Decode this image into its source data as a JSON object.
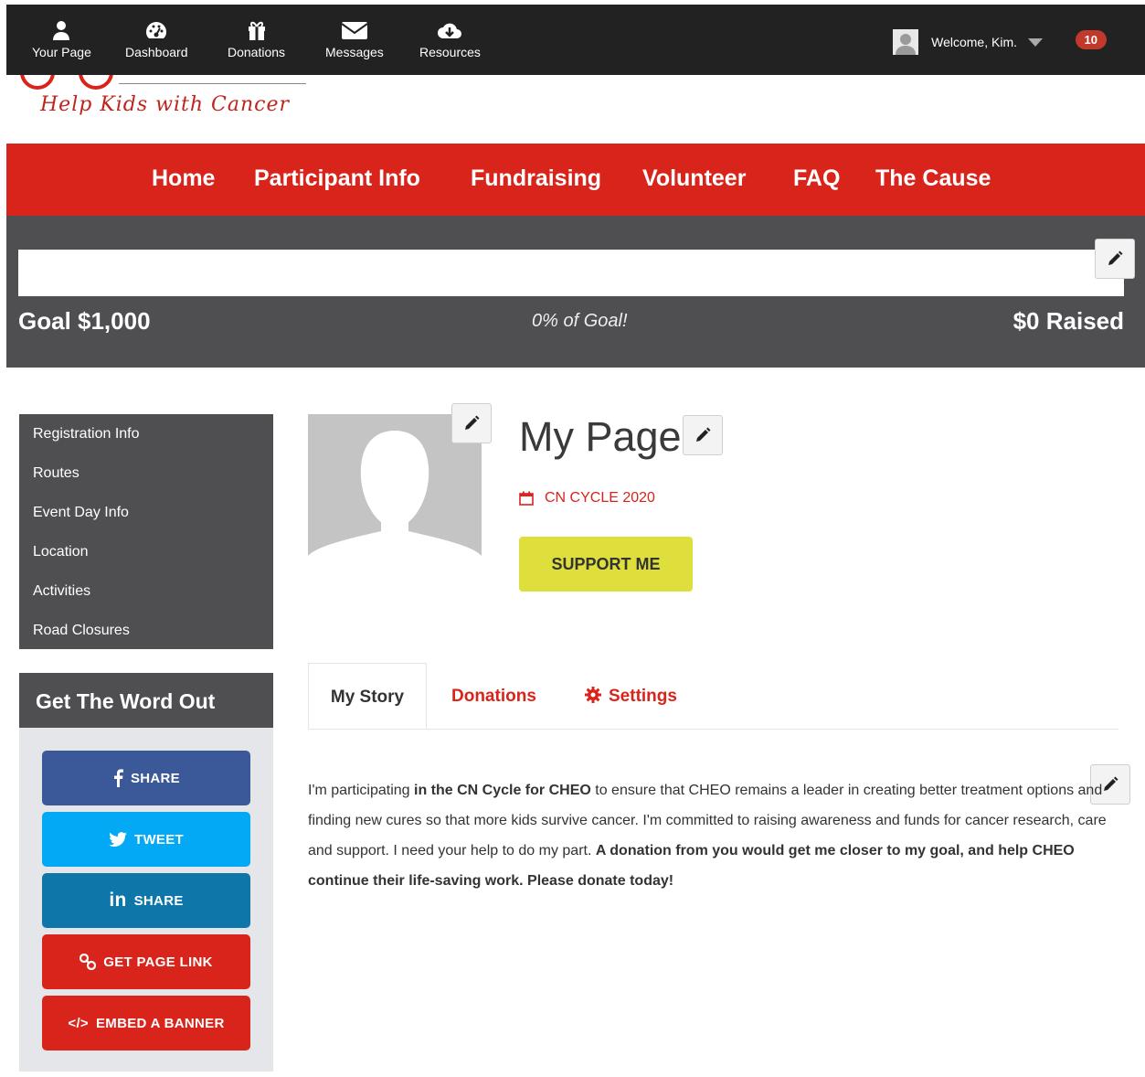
{
  "admin_bar": {
    "items": [
      {
        "label": "Your Page",
        "icon": "user-icon"
      },
      {
        "label": "Dashboard",
        "icon": "dashboard-icon"
      },
      {
        "label": "Donations",
        "icon": "gift-icon"
      },
      {
        "label": "Messages",
        "icon": "envelope-icon"
      },
      {
        "label": "Resources",
        "icon": "cloud-download-icon"
      }
    ],
    "welcome": "Welcome, Kim.",
    "notification_count": "10"
  },
  "logo": {
    "tagline": "Help Kids with Cancer"
  },
  "main_nav": [
    "Home",
    "Participant Info",
    "Fundraising",
    "Volunteer",
    "FAQ",
    "The Cause"
  ],
  "progress": {
    "goal": "Goal $1,000",
    "percent_text": "0% of Goal!",
    "raised": "$0 Raised",
    "fill_fraction": 0
  },
  "side_menu": [
    "Registration Info",
    "Routes",
    "Event Day Info",
    "Location",
    "Activities",
    "Road Closures"
  ],
  "share_panel": {
    "title": "Get The Word Out",
    "buttons": [
      {
        "label": "SHARE",
        "icon": "facebook-icon",
        "color": "#3b5998"
      },
      {
        "label": "TWEET",
        "icon": "twitter-icon",
        "color": "#03a9f4"
      },
      {
        "label": "SHARE",
        "icon": "linkedin-icon",
        "color": "#0e76a8"
      },
      {
        "label": "GET PAGE LINK",
        "icon": "link-icon",
        "color": "#d9241b"
      },
      {
        "label": "EMBED A BANNER",
        "icon": "code-icon",
        "color": "#d9241b"
      }
    ]
  },
  "profile": {
    "title": "My Page",
    "event": "CN CYCLE 2020",
    "support_label": "SUPPORT ME"
  },
  "tabs": {
    "story": "My Story",
    "donations": "Donations",
    "settings": "Settings"
  },
  "story": {
    "p1": "I'm participating ",
    "b1": "in the CN Cycle for CHEO",
    "p2": " to ensure that CHEO remains a leader in creating better treatment options and finding new cures so that more kids survive cancer. I'm committed to raising awareness and funds for cancer research, care and support. I need your help to do my part. ",
    "b2": "A donation from you would get me closer to my goal, and help CHEO continue their life-saving work. Please donate today!"
  },
  "colors": {
    "brand_red": "#d9241b",
    "dark_gray": "#4f4f52",
    "admin_bar": "#222222",
    "support_yellow": "#dede3c"
  }
}
